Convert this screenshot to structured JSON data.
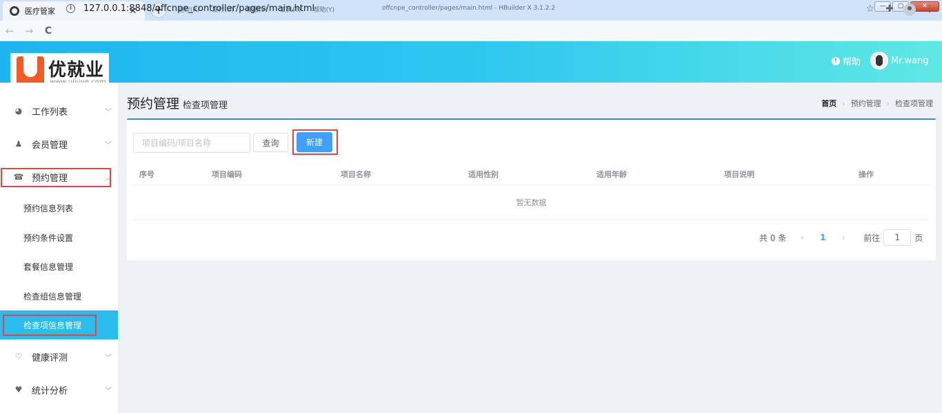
{
  "browser": {
    "tab_title": "医疗管家",
    "tab_close": "✕",
    "new_tab": "+",
    "hbuilder_menu": [
      "运行(R)",
      "发行(U)",
      "视图(V)",
      "工具(T)",
      "帮助(Y)"
    ],
    "hbuilder_title": "offcnpe_controller/pages/main.html - HBuilder X 3.1.2.2",
    "url": "127.0.0.1:8848/offcnpe_controller/pages/main.html",
    "back": "←",
    "forward": "→",
    "reload": "C"
  },
  "header": {
    "logo_text": "优就业",
    "logo_url": "www.ujiuye.com",
    "help_label": "帮助",
    "username": "Mr.wang"
  },
  "sidebar": {
    "menus": [
      {
        "label": "工作列表",
        "icon": "dashboard-icon"
      },
      {
        "label": "会员管理",
        "icon": "user-icon"
      },
      {
        "label": "预约管理",
        "icon": "phone-icon"
      },
      {
        "label": "健康评测",
        "icon": "stethoscope-icon"
      },
      {
        "label": "统计分析",
        "icon": "heartbeat-icon"
      }
    ],
    "submenus": [
      "预约信息列表",
      "预约条件设置",
      "套餐信息管理",
      "检查组信息管理",
      "检查项信息管理"
    ]
  },
  "page": {
    "title": "预约管理",
    "subtitle": "检查项管理",
    "breadcrumb": [
      "首页",
      "预约管理",
      "检查项管理"
    ]
  },
  "filter": {
    "search_placeholder": "项目编码/项目名称",
    "query_label": "查询",
    "new_label": "新建"
  },
  "table": {
    "columns": [
      "序号",
      "项目编码",
      "项目名称",
      "适用性别",
      "适用年龄",
      "项目说明",
      "操作"
    ],
    "empty_text": "暂无数据"
  },
  "pagination": {
    "total_label": "共 0 条",
    "current_page": "1",
    "goto_label": "前往",
    "goto_value": "1",
    "page_suffix": "页"
  },
  "colors": {
    "header_gradient_start": "#1fb4ef",
    "header_gradient_end": "#5ee8e4",
    "active_menu": "#2bbcee",
    "primary_button": "#409eff",
    "highlight_box": "#e84343"
  }
}
